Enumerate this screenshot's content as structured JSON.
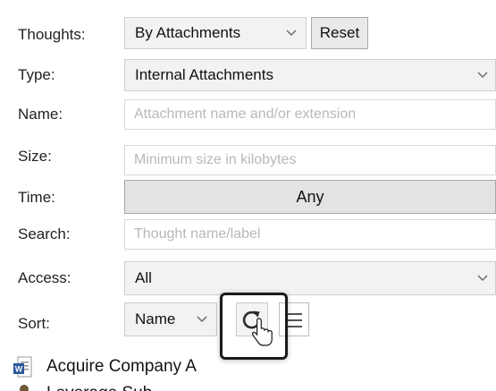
{
  "rows": {
    "thoughts_label": "Thoughts:",
    "thoughts_value": "By Attachments",
    "reset_label": "Reset",
    "type_label": "Type:",
    "type_value": "Internal Attachments",
    "name_label": "Name:",
    "name_placeholder": "Attachment name and/or extension",
    "size_label": "Size:",
    "size_placeholder": "Minimum size in kilobytes",
    "time_label": "Time:",
    "time_value": "Any",
    "search_label": "Search:",
    "search_placeholder": "Thought name/label",
    "access_label": "Access:",
    "access_value": "All",
    "sort_label": "Sort:",
    "sort_value": "Name"
  },
  "results": [
    {
      "label": "Acquire Company A",
      "icon": "word-document-icon"
    },
    {
      "label": "Leverage Sub...",
      "icon": "person-icon"
    }
  ],
  "colors": {
    "select_bg": "#f2f2f2",
    "button_bg": "#e9e9e9",
    "highlight_border": "#1b1b1b",
    "word_blue": "#2b579a"
  },
  "icons": [
    "chevron-down-icon",
    "refresh-icon",
    "list-view-icon",
    "mouse-cursor-icon",
    "word-document-icon",
    "person-icon"
  ]
}
